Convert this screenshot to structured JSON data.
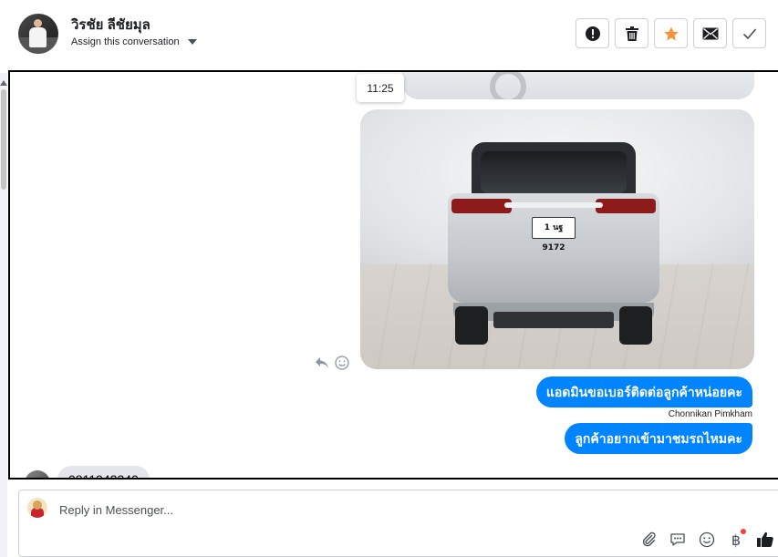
{
  "header": {
    "contact_name": "วิรชัย ลีชัยมุล",
    "assign_label": "Assign this conversation",
    "actions": [
      {
        "name": "mark-spam",
        "icon": "exclamation-icon"
      },
      {
        "name": "delete",
        "icon": "trash-icon"
      },
      {
        "name": "star",
        "icon": "star-icon",
        "color": "#f7923b"
      },
      {
        "name": "mark-unread",
        "icon": "envelope-icon"
      },
      {
        "name": "mark-done",
        "icon": "check-icon"
      }
    ]
  },
  "conversation": {
    "timestamp": "11:25",
    "photo_plate": "1 นฐ 9172",
    "messages": [
      {
        "text": "แอดมินขอเบอร์ติดต่อลูกค้าหน่อยคะ",
        "sender": "Chonnikan Pimkham"
      },
      {
        "text": "ลูกค้าอยากเข้ามาชมรถไหมคะ"
      }
    ],
    "incoming_partial": "0811942340"
  },
  "composer": {
    "placeholder": "Reply in Messenger...",
    "currency_symbol": "฿"
  },
  "colors": {
    "accent": "#0084ff",
    "star": "#f7923b",
    "notification": "#fa3e3e"
  }
}
